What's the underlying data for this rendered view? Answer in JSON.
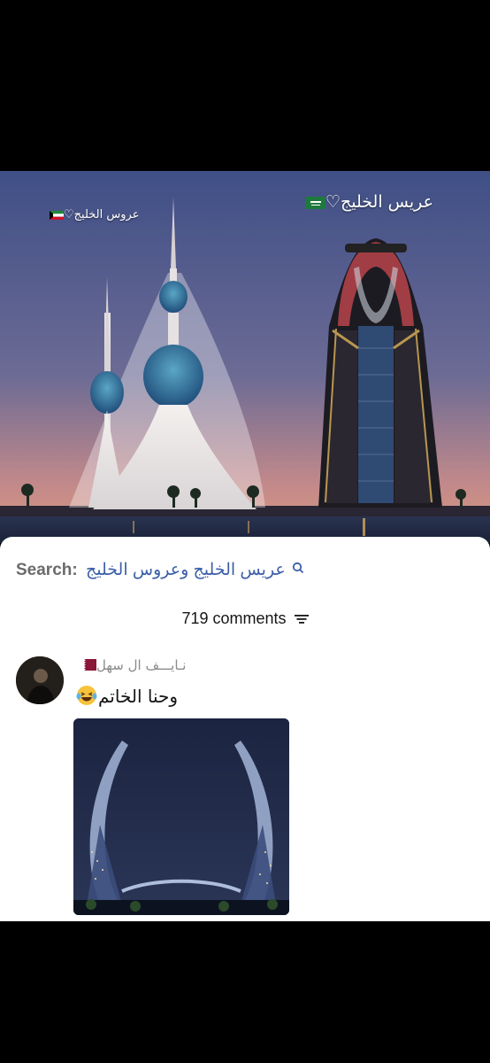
{
  "post": {
    "caption_right": "عريس الخليج",
    "caption_left": "عروس الخليج",
    "caption_right_flag": "saudi-flag",
    "caption_left_flag": "kuwait-flag"
  },
  "comments_sheet": {
    "search_label": "Search:",
    "search_query": "عريس الخليج وعروس الخليج",
    "comments_count": "719 comments",
    "comment": {
      "username": "نـايـــف ال سهل",
      "username_flag": "qatar-flag",
      "text": "وحنا الخاتم",
      "emoji": "laughing-tears-emoji"
    }
  },
  "colors": {
    "search_query": "#3b5fa8",
    "text_primary": "#161616",
    "text_secondary": "#8a8a8a"
  }
}
